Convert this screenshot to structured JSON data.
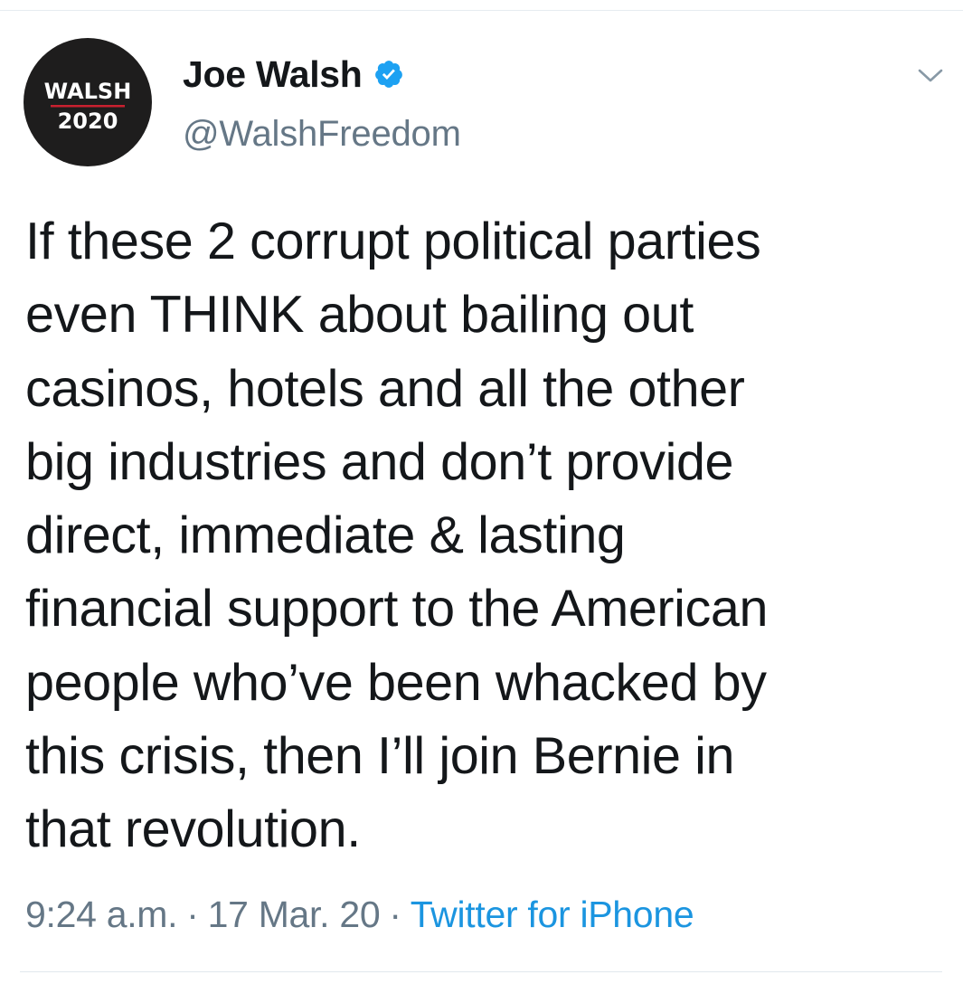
{
  "avatar": {
    "line1": "WALSH",
    "line2": "2020"
  },
  "author": {
    "display_name": "Joe Walsh",
    "handle": "@WalshFreedom",
    "verified": true
  },
  "menu": {
    "icon": "chevron-down-icon"
  },
  "tweet": {
    "text": "If these 2 corrupt political parties\neven THINK about bailing out\ncasinos, hotels and all the other\nbig industries and don’t provide\ndirect, immediate & lasting\nfinancial support to the American\npeople who’ve been whacked by\nthis crisis, then I’ll join Bernie in\nthat revolution."
  },
  "meta": {
    "time": "9:24 a.m.",
    "separator": "·",
    "date": "17 Mar. 20",
    "source": "Twitter for iPhone"
  },
  "colors": {
    "verified_badge": "#1da1f2",
    "link": "#1b95e0",
    "secondary_text": "#657786",
    "avatar_bg": "#1e1d1d",
    "avatar_underline": "#c8202f"
  }
}
